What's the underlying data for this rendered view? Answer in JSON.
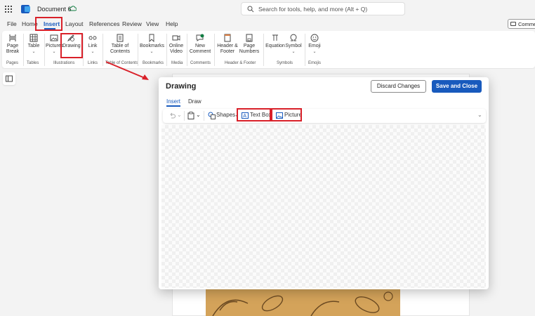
{
  "titlebar": {
    "doc_title": "Document 6",
    "search_placeholder": "Search for tools, help, and more (Alt + Q)"
  },
  "menu": {
    "items": [
      "File",
      "Home",
      "Insert",
      "Layout",
      "References",
      "Review",
      "View",
      "Help"
    ],
    "active": "Insert",
    "comments_label": "Comments"
  },
  "ribbon": {
    "buttons": {
      "page_break": [
        "Page",
        "Break"
      ],
      "table": "Table",
      "pictures": "Pictures",
      "drawing": "Drawing",
      "link": "Link",
      "toc": [
        "Table of",
        "Contents"
      ],
      "bookmarks": "Bookmarks",
      "online_video": [
        "Online",
        "Video"
      ],
      "new_comment": [
        "New",
        "Comment"
      ],
      "header_footer": [
        "Header &",
        "Footer"
      ],
      "page_numbers": [
        "Page",
        "Numbers"
      ],
      "equation": "Equation",
      "symbol": "Symbol",
      "emoji": "Emoji"
    },
    "groups": {
      "pages": "Pages",
      "tables": "Tables",
      "illustrations": "Illustrations",
      "links": "Links",
      "table_of_contents": "Table of Contents",
      "bookmarks": "Bookmarks",
      "media": "Media",
      "comments": "Comments",
      "header_footer": "Header & Footer",
      "symbols": "Symbols",
      "emojis": "Emojis"
    }
  },
  "dialog": {
    "title": "Drawing",
    "discard_label": "Discard Changes",
    "save_label": "Save and Close",
    "tabs": [
      "Insert",
      "Draw"
    ],
    "active_tab": "Insert",
    "toolbar": {
      "shapes": "Shapes",
      "text_box": "Text Box",
      "picture": "Picture"
    }
  },
  "colors": {
    "accent": "#185abd",
    "highlight": "#d92029"
  },
  "icons": [
    "waffle-icon",
    "word-logo-icon",
    "cloud-sync-icon",
    "search-icon",
    "comment-icon",
    "undo-icon",
    "clipboard-icon",
    "shapes-icon",
    "text-box-icon",
    "picture-icon"
  ]
}
